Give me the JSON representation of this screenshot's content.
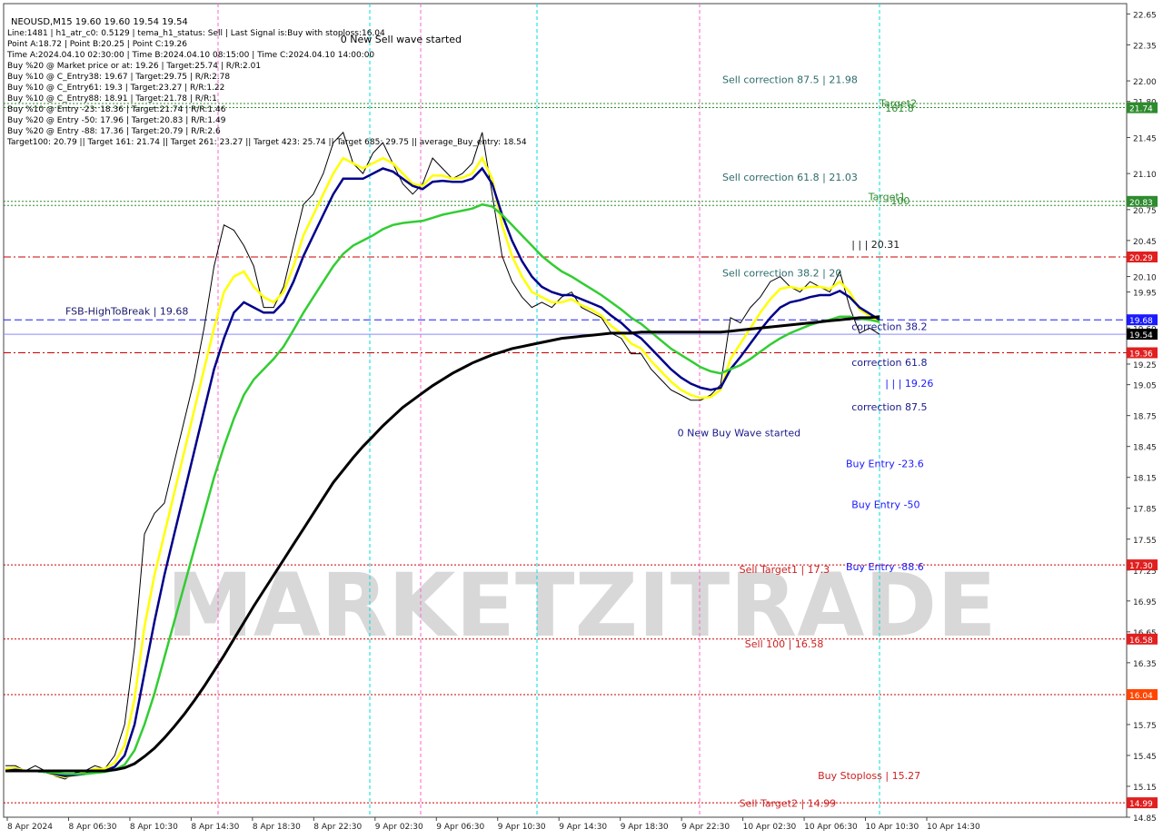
{
  "window": {
    "title": "NEOUSD,M15  19.60 19.60 19.54 19.54"
  },
  "info_panel": [
    "Line:1481 | h1_atr_c0: 0.5129 | tema_h1_status: Sell | Last Signal is:Buy with stoploss:16.04",
    "Point A:18.72 | Point B:20.25 | Point C:19.26",
    "Time A:2024.04.10 02:30:00 | Time B:2024.04.10 08:15:00 | Time C:2024.04.10 14:00:00",
    "Buy %20 @ Market price or at: 19.26 | Target:25.74 | R/R:2.01",
    "Buy %10 @ C_Entry38: 19.67 | Target:29.75 | R/R:2.78",
    "Buy %10 @ C_Entry61: 19.3 | Target:23.27 | R/R:1.22",
    "Buy %10 @ C_Entry88: 18.91 | Target:21.78 | R/R:1",
    "Buy %10 @ Entry -23: 18.36 | Target:21.74 | R/R:1.46",
    "Buy %20 @ Entry -50: 17.96 | Target:20.83 | R/R:1.49",
    "Buy %20 @ Entry -88: 17.36 | Target:20.79 | R/R:2.6",
    "Target100: 20.79 || Target 161: 21.74 || Target 261: 23.27 || Target 423: 25.74 || Target 685: 29.75 || average_Buy_entry: 18.54"
  ],
  "watermark": "MARKETZITRADE",
  "chart_data": {
    "type": "line",
    "symbol": "NEOUSD",
    "timeframe": "M15",
    "ylim": [
      14.85,
      22.75
    ],
    "y_ticks": [
      "22.65",
      "22.35",
      "22.00",
      "21.80",
      "21.45",
      "21.10",
      "20.75",
      "20.45",
      "20.10",
      "19.95",
      "19.60",
      "19.25",
      "19.05",
      "18.75",
      "18.45",
      "18.15",
      "17.85",
      "17.55",
      "17.25",
      "16.95",
      "16.65",
      "16.35",
      "16.05",
      "15.75",
      "15.45",
      "15.15",
      "14.85"
    ],
    "x_ticks": [
      "8 Apr 2024",
      "8 Apr 06:30",
      "8 Apr 10:30",
      "8 Apr 14:30",
      "8 Apr 18:30",
      "8 Apr 22:30",
      "9 Apr 02:30",
      "9 Apr 06:30",
      "9 Apr 10:30",
      "9 Apr 14:30",
      "9 Apr 18:30",
      "9 Apr 22:30",
      "10 Apr 02:30",
      "10 Apr 06:30",
      "10 Apr 10:30",
      "10 Apr 14:30"
    ],
    "price_badges": [
      {
        "label": "21.74",
        "value": 21.74,
        "color": "#2e8b2e"
      },
      {
        "label": "20.83",
        "value": 20.83,
        "color": "#2e8b2e"
      },
      {
        "label": "20.29",
        "value": 20.29,
        "color": "#e02020"
      },
      {
        "label": "19.68",
        "value": 19.68,
        "color": "#1a1aff"
      },
      {
        "label": "19.54",
        "value": 19.54,
        "color": "#000000"
      },
      {
        "label": "19.36",
        "value": 19.36,
        "color": "#e02020"
      },
      {
        "label": "17.30",
        "value": 17.3,
        "color": "#e02020"
      },
      {
        "label": "16.58",
        "value": 16.58,
        "color": "#e02020"
      },
      {
        "label": "16.04",
        "value": 16.04,
        "color": "#ff4500"
      },
      {
        "label": "14.99",
        "value": 14.99,
        "color": "#e02020"
      }
    ],
    "h_levels": [
      {
        "value": 21.78,
        "color": "#2e8b2e",
        "style": "dotted"
      },
      {
        "value": 21.74,
        "color": "#2e8b2e",
        "style": "dotted"
      },
      {
        "value": 20.83,
        "color": "#2e8b2e",
        "style": "dotted"
      },
      {
        "value": 20.79,
        "color": "#2e8b2e",
        "style": "dotted"
      },
      {
        "value": 20.29,
        "color": "#cc0000",
        "style": "dashdot"
      },
      {
        "value": 19.68,
        "color": "#1a1aff",
        "style": "dashed"
      },
      {
        "value": 19.54,
        "color": "#8a8aff",
        "style": "solid"
      },
      {
        "value": 19.36,
        "color": "#cc0000",
        "style": "dashdot"
      },
      {
        "value": 17.3,
        "color": "#cc0000",
        "style": "dotted"
      },
      {
        "value": 16.58,
        "color": "#cc0000",
        "style": "dotted"
      },
      {
        "value": 16.04,
        "color": "#cc0000",
        "style": "dotted"
      },
      {
        "value": 14.99,
        "color": "#cc0000",
        "style": "dotted"
      }
    ],
    "annotations": [
      {
        "text": "0 New Sell wave started",
        "x_frac": 0.3,
        "value": 22.37,
        "color": "#000000"
      },
      {
        "text": "Sell correction 87.5 | 21.98",
        "x_frac": 0.64,
        "value": 21.98,
        "color": "#2e6b6b"
      },
      {
        "text": "Target2",
        "x_frac": 0.78,
        "value": 21.75,
        "color": "#2e8b2e"
      },
      {
        "text": "161.8",
        "x_frac": 0.785,
        "value": 21.7,
        "color": "#2e8b2e"
      },
      {
        "text": "Sell correction 61.8 | 21.03",
        "x_frac": 0.64,
        "value": 21.03,
        "color": "#2e6b6b"
      },
      {
        "text": "Target1",
        "x_frac": 0.77,
        "value": 20.84,
        "color": "#2e8b2e"
      },
      {
        "text": "100",
        "x_frac": 0.79,
        "value": 20.8,
        "color": "#2e8b2e"
      },
      {
        "text": "| | | 20.31",
        "x_frac": 0.755,
        "value": 20.38,
        "color": "#1a1a1a"
      },
      {
        "text": "Sell correction 38.2 | 20",
        "x_frac": 0.64,
        "value": 20.1,
        "color": "#2e6b6b"
      },
      {
        "text": "FSB-HighToBreak | 19.68",
        "x_frac": 0.055,
        "value": 19.73,
        "color": "#1a1a6b"
      },
      {
        "text": "correction 38.2",
        "x_frac": 0.755,
        "value": 19.58,
        "color": "#1a1a8b"
      },
      {
        "text": "correction 61.8",
        "x_frac": 0.755,
        "value": 19.23,
        "color": "#1a1a8b"
      },
      {
        "text": "| | | 19.26",
        "x_frac": 0.785,
        "value": 19.03,
        "color": "#1a1aff"
      },
      {
        "text": "correction 87.5",
        "x_frac": 0.755,
        "value": 18.8,
        "color": "#1a1a8b"
      },
      {
        "text": "0 New Buy Wave started",
        "x_frac": 0.6,
        "value": 18.55,
        "color": "#1a1a8b"
      },
      {
        "text": "Buy Entry -23.6",
        "x_frac": 0.75,
        "value": 18.25,
        "color": "#1a1aff"
      },
      {
        "text": "Buy Entry -50",
        "x_frac": 0.755,
        "value": 17.85,
        "color": "#1a1aff"
      },
      {
        "text": "Buy Entry -88.6",
        "x_frac": 0.75,
        "value": 17.25,
        "color": "#1a1aff"
      },
      {
        "text": "Sell Target1 | 17.3",
        "x_frac": 0.655,
        "value": 17.22,
        "color": "#cc2222"
      },
      {
        "text": "Sell 100 | 16.58",
        "x_frac": 0.66,
        "value": 16.5,
        "color": "#cc2222"
      },
      {
        "text": "Buy Stoploss | 15.27",
        "x_frac": 0.725,
        "value": 15.22,
        "color": "#cc2222"
      },
      {
        "text": "Sell Target2 | 14.99",
        "x_frac": 0.655,
        "value": 14.95,
        "color": "#cc2222"
      }
    ],
    "series": [
      {
        "name": "close",
        "color": "#000000",
        "values": [
          15.35,
          15.35,
          15.3,
          15.35,
          15.3,
          15.25,
          15.22,
          15.28,
          15.3,
          15.35,
          15.32,
          15.45,
          15.75,
          16.5,
          17.6,
          17.8,
          17.9,
          18.3,
          18.7,
          19.1,
          19.6,
          20.2,
          20.6,
          20.55,
          20.4,
          20.2,
          19.8,
          19.8,
          20.0,
          20.4,
          20.8,
          20.9,
          21.1,
          21.4,
          21.5,
          21.2,
          21.1,
          21.3,
          21.4,
          21.2,
          21.0,
          20.9,
          21.0,
          21.25,
          21.15,
          21.05,
          21.1,
          21.2,
          21.5,
          20.9,
          20.3,
          20.05,
          19.9,
          19.8,
          19.85,
          19.8,
          19.9,
          19.95,
          19.8,
          19.75,
          19.7,
          19.55,
          19.5,
          19.35,
          19.35,
          19.2,
          19.1,
          19.0,
          18.95,
          18.9,
          18.9,
          18.95,
          19.05,
          19.7,
          19.65,
          19.8,
          19.9,
          20.05,
          20.1,
          20.0,
          19.95,
          20.05,
          20.0,
          19.95,
          20.15,
          19.8,
          19.55,
          19.6,
          19.54
        ]
      },
      {
        "name": "fast_ma",
        "color": "#ffff00",
        "values": [
          15.32,
          15.33,
          15.3,
          15.3,
          15.29,
          15.26,
          15.24,
          15.26,
          15.28,
          15.32,
          15.32,
          15.38,
          15.55,
          16.0,
          16.7,
          17.2,
          17.6,
          18.0,
          18.4,
          18.8,
          19.2,
          19.6,
          19.95,
          20.1,
          20.15,
          20.0,
          19.9,
          19.85,
          19.95,
          20.2,
          20.5,
          20.7,
          20.9,
          21.1,
          21.25,
          21.2,
          21.15,
          21.2,
          21.25,
          21.2,
          21.1,
          21.0,
          20.98,
          21.08,
          21.08,
          21.05,
          21.06,
          21.1,
          21.25,
          21.05,
          20.6,
          20.3,
          20.1,
          19.95,
          19.9,
          19.85,
          19.85,
          19.88,
          19.82,
          19.78,
          19.72,
          19.62,
          19.55,
          19.45,
          19.4,
          19.28,
          19.18,
          19.08,
          19.0,
          18.95,
          18.92,
          18.93,
          19.0,
          19.3,
          19.45,
          19.6,
          19.75,
          19.88,
          19.98,
          20.0,
          19.98,
          20.0,
          20.0,
          19.98,
          20.05,
          19.95,
          19.78,
          19.72,
          19.65
        ]
      },
      {
        "name": "mid_ma",
        "color": "#00008b",
        "values": [
          15.3,
          15.31,
          15.3,
          15.3,
          15.29,
          15.27,
          15.25,
          15.26,
          15.27,
          15.3,
          15.3,
          15.34,
          15.45,
          15.75,
          16.25,
          16.75,
          17.2,
          17.6,
          18.0,
          18.4,
          18.8,
          19.2,
          19.5,
          19.75,
          19.85,
          19.8,
          19.75,
          19.75,
          19.85,
          20.05,
          20.3,
          20.5,
          20.7,
          20.9,
          21.05,
          21.05,
          21.05,
          21.1,
          21.15,
          21.12,
          21.05,
          20.98,
          20.95,
          21.02,
          21.03,
          21.02,
          21.02,
          21.05,
          21.15,
          21.0,
          20.7,
          20.45,
          20.25,
          20.1,
          20.0,
          19.95,
          19.92,
          19.92,
          19.88,
          19.84,
          19.8,
          19.72,
          19.65,
          19.56,
          19.5,
          19.4,
          19.3,
          19.2,
          19.12,
          19.06,
          19.02,
          19.0,
          19.02,
          19.2,
          19.32,
          19.45,
          19.58,
          19.7,
          19.8,
          19.85,
          19.87,
          19.9,
          19.92,
          19.92,
          19.96,
          19.9,
          19.8,
          19.74,
          19.68
        ]
      },
      {
        "name": "slow_ma",
        "color": "#32cd32",
        "values": [
          15.3,
          15.3,
          15.3,
          15.3,
          15.29,
          15.28,
          15.27,
          15.27,
          15.27,
          15.28,
          15.29,
          15.31,
          15.36,
          15.5,
          15.75,
          16.05,
          16.4,
          16.75,
          17.1,
          17.45,
          17.8,
          18.15,
          18.45,
          18.72,
          18.95,
          19.1,
          19.2,
          19.3,
          19.42,
          19.58,
          19.75,
          19.9,
          20.05,
          20.2,
          20.32,
          20.4,
          20.45,
          20.5,
          20.56,
          20.6,
          20.62,
          20.63,
          20.64,
          20.67,
          20.7,
          20.72,
          20.74,
          20.76,
          20.8,
          20.78,
          20.7,
          20.6,
          20.5,
          20.4,
          20.3,
          20.22,
          20.15,
          20.1,
          20.04,
          19.98,
          19.92,
          19.85,
          19.78,
          19.7,
          19.64,
          19.56,
          19.48,
          19.4,
          19.34,
          19.28,
          19.22,
          19.18,
          19.16,
          19.2,
          19.24,
          19.3,
          19.37,
          19.44,
          19.5,
          19.55,
          19.59,
          19.63,
          19.66,
          19.68,
          19.71,
          19.71,
          19.69,
          19.68,
          19.66
        ]
      },
      {
        "name": "base_ma",
        "color": "#000000",
        "values": [
          15.3,
          15.3,
          15.3,
          15.3,
          15.3,
          15.3,
          15.3,
          15.3,
          15.3,
          15.3,
          15.3,
          15.31,
          15.33,
          15.37,
          15.44,
          15.52,
          15.62,
          15.73,
          15.85,
          15.98,
          16.12,
          16.27,
          16.42,
          16.58,
          16.74,
          16.9,
          17.05,
          17.2,
          17.35,
          17.5,
          17.65,
          17.8,
          17.95,
          18.1,
          18.22,
          18.34,
          18.45,
          18.55,
          18.65,
          18.74,
          18.83,
          18.9,
          18.97,
          19.04,
          19.1,
          19.16,
          19.21,
          19.26,
          19.3,
          19.34,
          19.37,
          19.4,
          19.42,
          19.44,
          19.46,
          19.48,
          19.5,
          19.51,
          19.52,
          19.53,
          19.54,
          19.55,
          19.55,
          19.55,
          19.56,
          19.56,
          19.56,
          19.56,
          19.56,
          19.56,
          19.56,
          19.56,
          19.56,
          19.57,
          19.58,
          19.59,
          19.6,
          19.61,
          19.62,
          19.63,
          19.64,
          19.65,
          19.66,
          19.67,
          19.68,
          19.69,
          19.7,
          19.7,
          19.71
        ]
      }
    ]
  }
}
